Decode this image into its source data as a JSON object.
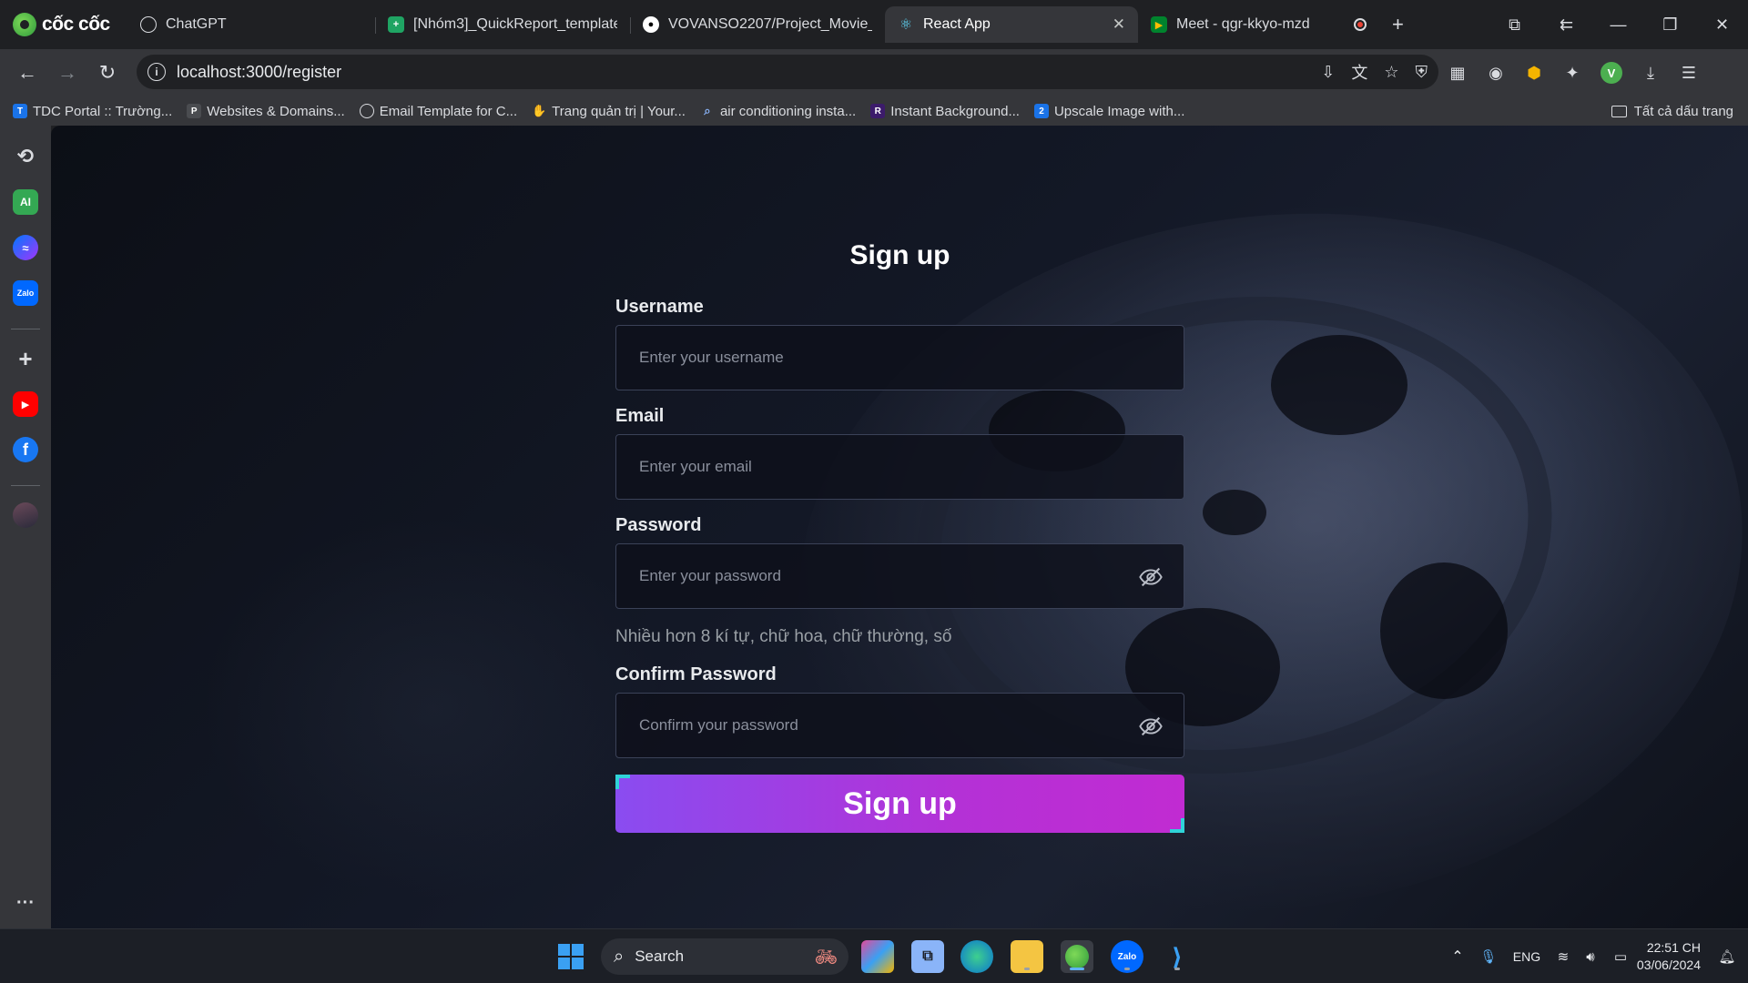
{
  "browser": {
    "brand": "cốc cốc",
    "tabs": [
      {
        "title": "ChatGPT",
        "icon": "chatgpt-icon"
      },
      {
        "title": "[Nhóm3]_QuickReport_template",
        "icon": "sheets-icon"
      },
      {
        "title": "VOVANSO2207/Project_Movie_",
        "icon": "github-icon"
      },
      {
        "title": "React App",
        "icon": "react-icon",
        "active": true
      },
      {
        "title": "Meet - qgr-kkyo-mzd",
        "icon": "meet-icon"
      }
    ],
    "url": "localhost:3000/register",
    "profile_initial": "V",
    "bookmarks": [
      {
        "label": "TDC Portal :: Trường...",
        "icon": "tdc-icon"
      },
      {
        "label": "Websites & Domains...",
        "icon": "plesk-icon"
      },
      {
        "label": "Email Template for C...",
        "icon": "chatgpt-icon"
      },
      {
        "label": "Trang quản trị | Your...",
        "icon": "hand-icon"
      },
      {
        "label": "air conditioning insta...",
        "icon": "search-icon"
      },
      {
        "label": "Instant Background...",
        "icon": "remove-bg-icon"
      },
      {
        "label": "Upscale Image with...",
        "icon": "upscale-icon"
      }
    ],
    "all_bookmarks": "Tất cả dấu trang"
  },
  "form": {
    "title": "Sign up",
    "username_label": "Username",
    "username_placeholder": "Enter your username",
    "email_label": "Email",
    "email_placeholder": "Enter your email",
    "password_label": "Password",
    "password_placeholder": "Enter your password",
    "password_hint": "Nhiều hơn 8 kí tự, chữ hoa, chữ thường, số",
    "confirm_label": "Confirm Password",
    "confirm_placeholder": "Confirm your password",
    "submit_label": "Sign up"
  },
  "taskbar": {
    "search_label": "Search",
    "language": "ENG",
    "time": "22:51 CH",
    "date": "03/06/2024"
  },
  "colors": {
    "button_gradient_start": "#8a4cf0",
    "button_gradient_end": "#c12bd2",
    "corner_accent": "#2fd3d8"
  }
}
